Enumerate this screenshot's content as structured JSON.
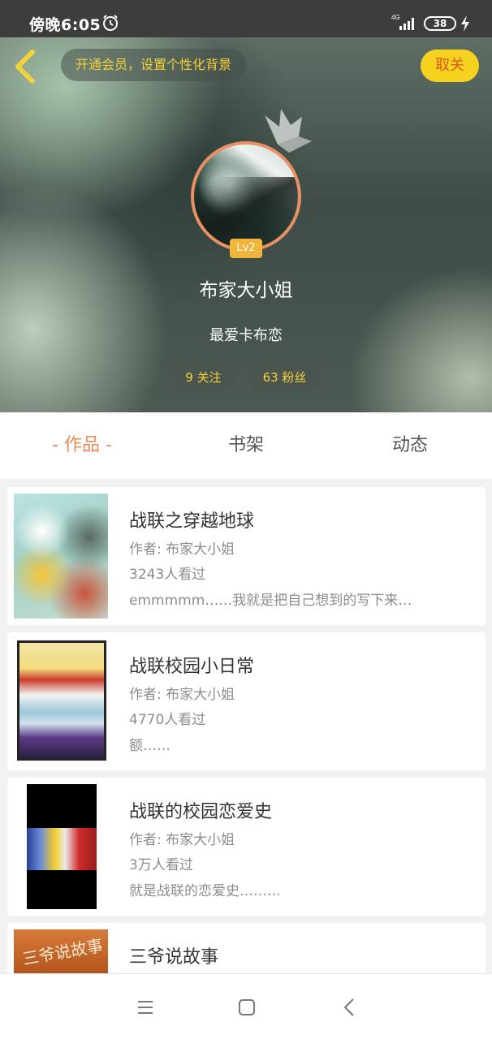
{
  "status_bar": {
    "time": "傍晚6:05",
    "network": "4G",
    "battery": "38",
    "icons": [
      "alarm-icon",
      "signal-icon",
      "battery-icon",
      "charging-bolt-icon"
    ]
  },
  "header": {
    "vip_banner": "开通会员，设置个性化背景",
    "unfollow_label": "取关",
    "level": "Lv2",
    "username": "布家大小姐",
    "signature": "最爱卡布恋",
    "following": "9 关注",
    "fans": "63 粉丝",
    "icons": [
      "back-arrow-icon",
      "crown-icon"
    ]
  },
  "tabs": [
    {
      "label": "- 作品 -",
      "active": true
    },
    {
      "label": "书架",
      "active": false
    },
    {
      "label": "动态",
      "active": false
    }
  ],
  "books": [
    {
      "title": "战联之穿越地球",
      "author": "作者: 布家大小姐",
      "views": "3243人看过",
      "desc": "emmmmm……我就是把自己想到的写下来…"
    },
    {
      "title": "战联校园小日常",
      "author": "作者: 布家大小姐",
      "views": "4770人看过",
      "desc": "额……"
    },
    {
      "title": "战联的校园恋爱史",
      "author": "作者: 布家大小姐",
      "views": "3万人看过",
      "desc": "就是战联的恋爱史………"
    },
    {
      "title": "三爷说故事",
      "cover_text": "三爷说故事"
    }
  ],
  "nav_bar": {
    "icons": [
      "menu-icon",
      "home-square-icon",
      "back-chevron-icon"
    ]
  },
  "colors": {
    "accent": "#ee8a55",
    "gold": "#f3d23a",
    "button_yellow": "#f6d21f"
  }
}
